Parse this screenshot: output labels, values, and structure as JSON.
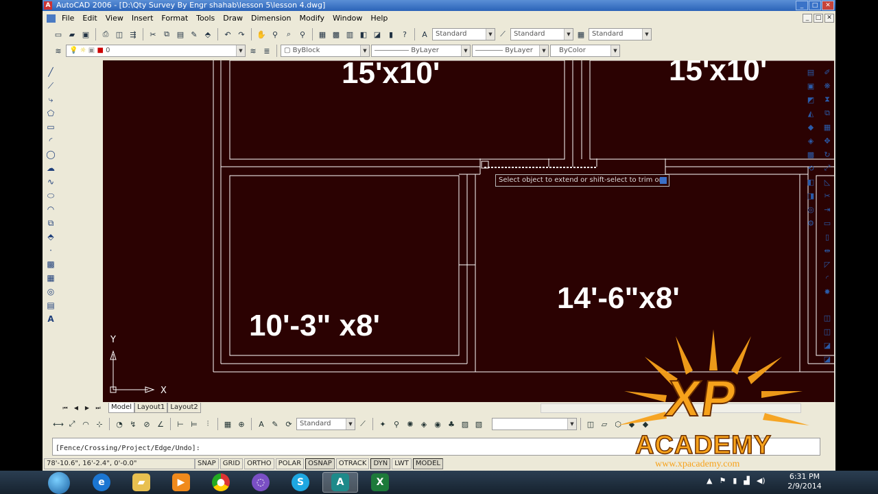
{
  "window": {
    "title": "AutoCAD 2006 - [D:\\Qty Survey By Engr shahab\\lesson 5\\lesson 4.dwg]",
    "controls": [
      "_",
      "□",
      "✕"
    ]
  },
  "menu": [
    "File",
    "Edit",
    "View",
    "Insert",
    "Format",
    "Tools",
    "Draw",
    "Dimension",
    "Modify",
    "Window",
    "Help"
  ],
  "styles_toolbar": {
    "text_style": "Standard",
    "dim_style": "Standard",
    "table_style": "Standard"
  },
  "properties_toolbar": {
    "layer": "0",
    "color": "ByBlock",
    "linetype": "ByLayer",
    "lineweight": "ByLayer",
    "plotstyle": "ByColor"
  },
  "drawing": {
    "room_labels": [
      "15'x10'",
      "15'x10'",
      "10'-3\" x8'",
      "14'-6\"x8'"
    ],
    "tooltip": "Select object to extend or shift-select to trim or",
    "ucs": {
      "y_label": "Y",
      "x_label": "X"
    },
    "background_color": "#2B0202"
  },
  "layout_tabs": [
    "Model",
    "Layout1",
    "Layout2"
  ],
  "active_tab": "Model",
  "bottom_toolbar": {
    "dim_style": "Standard",
    "extra_combo": ""
  },
  "command_line": "[Fence/Crossing/Project/Edge/Undo]:",
  "status": {
    "coordinates": "78'-10.6\", 16'-2.4\", 0'-0.0\"",
    "buttons": [
      "SNAP",
      "GRID",
      "ORTHO",
      "POLAR",
      "OSNAP",
      "OTRACK",
      "DYN",
      "LWT",
      "MODEL"
    ]
  },
  "watermark": {
    "brand": "XP",
    "tagline": "ACADEMY",
    "url": "www.xpacademy.com"
  },
  "taskbar": {
    "time": "6:31 PM",
    "date": "2/9/2014",
    "apps": [
      "ie",
      "explorer",
      "media-player",
      "chrome",
      "app-swirl",
      "skype",
      "autocad",
      "excel"
    ]
  }
}
